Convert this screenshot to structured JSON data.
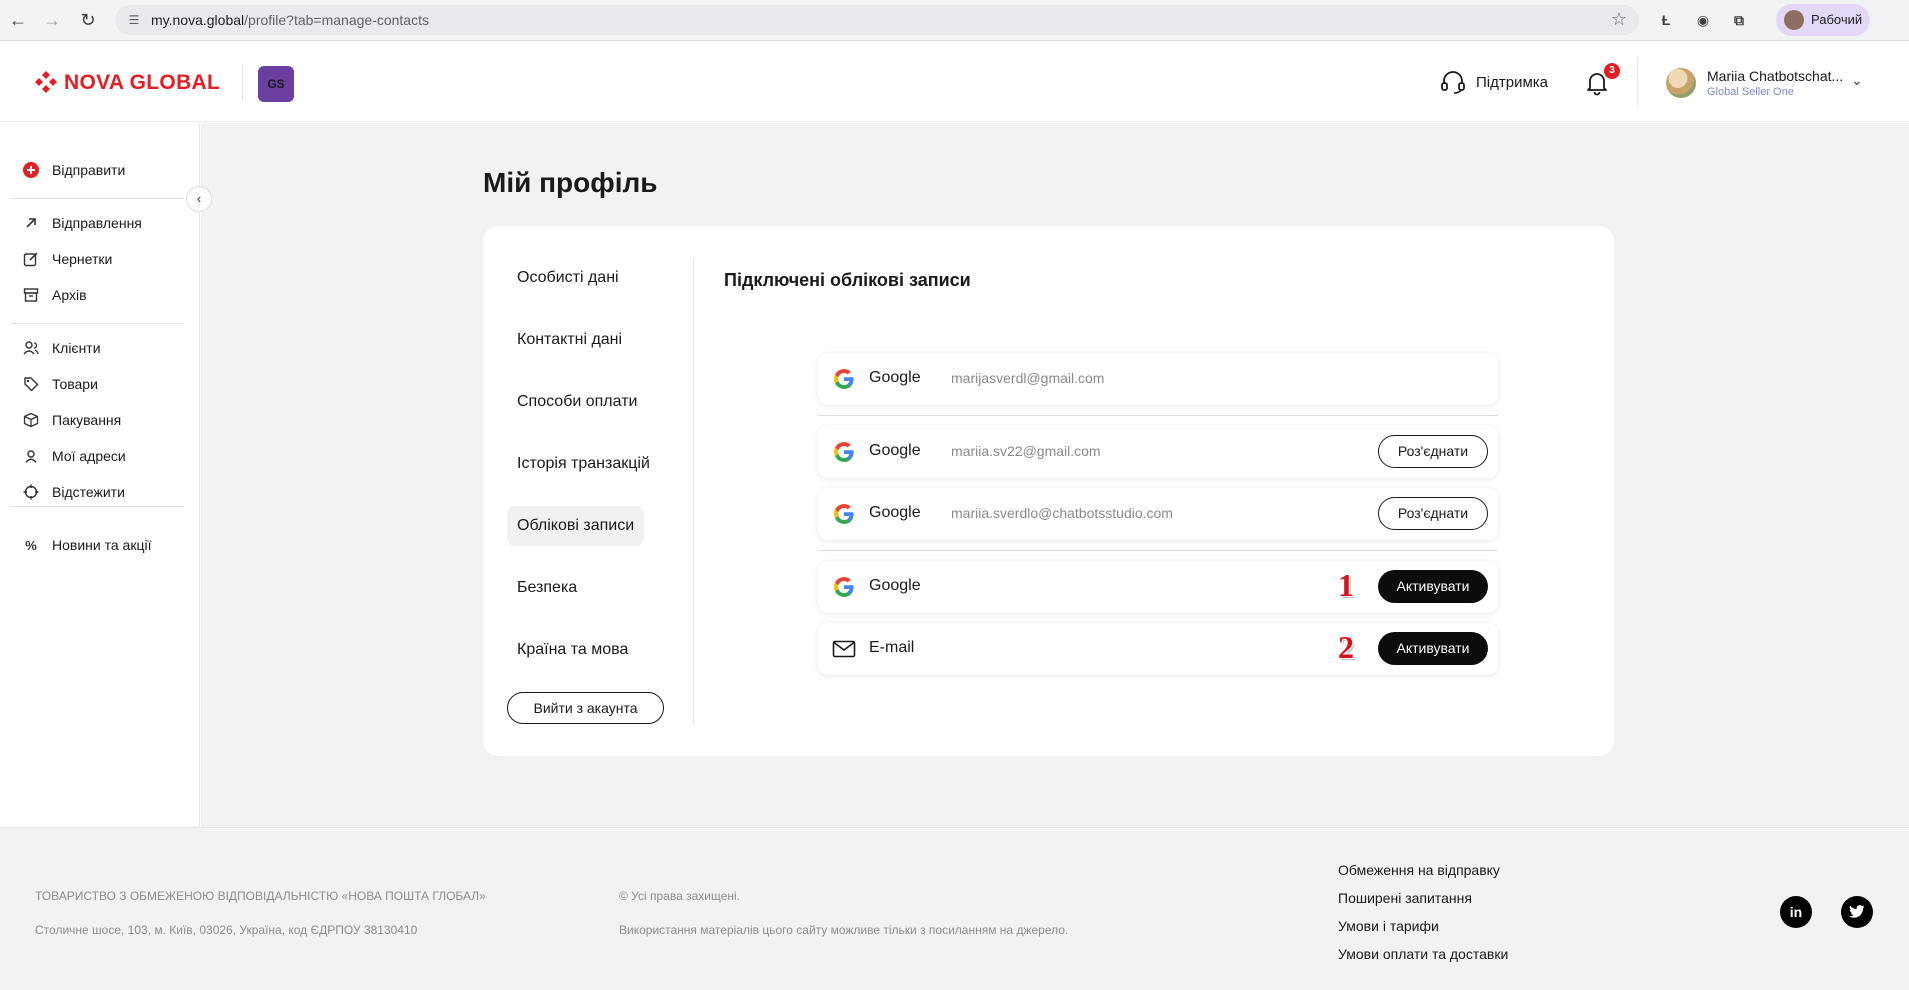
{
  "browser": {
    "url_host": "my.nova.global",
    "url_path": "/profile?tab=manage-contacts",
    "profile_label": "Рабочий"
  },
  "header": {
    "brand": "NOVA GLOBAL",
    "badge": "GS",
    "support_label": "Підтримка",
    "notifications_count": "3",
    "user_name": "Mariia Chatbotschat...",
    "user_role": "Global Seller One"
  },
  "sidebar": {
    "send": "Відправити",
    "items": [
      "Відправлення",
      "Чернетки",
      "Архів",
      "Клієнти",
      "Товари",
      "Пакування",
      "Мої адреси",
      "Відстежити",
      "Новини та акції"
    ]
  },
  "page": {
    "title": "Мій профіль",
    "tabs": [
      "Особисті дані",
      "Контактні дані",
      "Способи оплати",
      "Історія транзакцій",
      "Облікові записи",
      "Безпека",
      "Країна та мова"
    ],
    "active_tab": "Облікові записи",
    "logout": "Вийти з акаунта",
    "section_title": "Підключені облікові записи"
  },
  "accounts": [
    {
      "provider": "Google",
      "email": "marijasverdl@gmail.com",
      "action": ""
    },
    {
      "provider": "Google",
      "email": "mariia.sv22@gmail.com",
      "action": "Роз'єднати"
    },
    {
      "provider": "Google",
      "email": "mariia.sverdlo@chatbotsstudio.com",
      "action": "Роз'єднати"
    },
    {
      "provider": "Google",
      "email": "",
      "action": "Активувати",
      "marker": "1"
    },
    {
      "provider": "E-mail",
      "email": "",
      "action": "Активувати",
      "marker": "2"
    }
  ],
  "footer": {
    "company": "ТОВАРИСТВО З ОБМЕЖЕНОЮ ВІДПОВІДАЛЬНІСТЮ «НОВА ПОШТА ГЛОБАЛ»",
    "address": "Столичне шосе, 103, м. Київ, 03026, Україна, код ЄДРПОУ 38130410",
    "rights": "© Усі права захищені.",
    "usage": "Використання матеріалів цього сайту можливе тільки з посиланням на джерело.",
    "links": [
      "Обмеження на відправку",
      "Поширені запитання",
      "Умови і тарифи",
      "Умови оплати та доставки"
    ],
    "social": [
      "in",
      "twitter"
    ]
  },
  "colors": {
    "brand_red": "#e31e24",
    "badge_purple": "#6b3fa0",
    "marker_red": "#d8101a"
  }
}
